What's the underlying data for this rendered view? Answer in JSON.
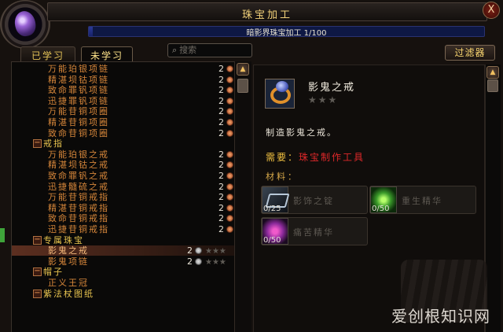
{
  "window": {
    "title": "珠宝加工",
    "close_label": "X"
  },
  "skill": {
    "text": "暗影界珠宝加工 1/100",
    "progress": 0.01
  },
  "tabs": [
    {
      "label": "已学习",
      "active": false
    },
    {
      "label": "未学习",
      "active": true
    }
  ],
  "search": {
    "placeholder": "搜索"
  },
  "filter": {
    "label": "过滤器"
  },
  "list": {
    "rows": [
      {
        "kind": "recipe",
        "name": "万能珀银项链",
        "count": "2"
      },
      {
        "kind": "recipe",
        "name": "精湛坝钴项链",
        "count": "2"
      },
      {
        "kind": "recipe",
        "name": "致命罪钒项链",
        "count": "2"
      },
      {
        "kind": "recipe",
        "name": "迅捷罪钒项链",
        "count": "2"
      },
      {
        "kind": "recipe",
        "name": "万能苷铜项圈",
        "count": "2"
      },
      {
        "kind": "recipe",
        "name": "精湛苷铜项圈",
        "count": "2"
      },
      {
        "kind": "recipe",
        "name": "致命苷铜项圈",
        "count": "2"
      },
      {
        "kind": "category",
        "name": "戒指"
      },
      {
        "kind": "recipe",
        "name": "万能珀银之戒",
        "count": "2"
      },
      {
        "kind": "recipe",
        "name": "精湛坝钴之戒",
        "count": "2"
      },
      {
        "kind": "recipe",
        "name": "致命罪钒之戒",
        "count": "2"
      },
      {
        "kind": "recipe",
        "name": "迅捷髓硫之戒",
        "count": "2"
      },
      {
        "kind": "recipe",
        "name": "万能苷铜戒指",
        "count": "2"
      },
      {
        "kind": "recipe",
        "name": "精湛苷铜戒指",
        "count": "2"
      },
      {
        "kind": "recipe",
        "name": "致命苷铜戒指",
        "count": "2"
      },
      {
        "kind": "recipe",
        "name": "迅捷苷铜戒指",
        "count": "2"
      },
      {
        "kind": "category",
        "name": "专属珠宝"
      },
      {
        "kind": "sub",
        "name": "影鬼之戒",
        "count": "2",
        "selected": true
      },
      {
        "kind": "sub",
        "name": "影鬼项链",
        "count": "2"
      },
      {
        "kind": "category",
        "name": "帽子"
      },
      {
        "kind": "recipe",
        "name": "正义王冠"
      },
      {
        "kind": "category",
        "name": "紫法杖图纸"
      }
    ]
  },
  "detail": {
    "item_name": "影鬼之戒",
    "quality_stars": "★★★",
    "description": "制造影鬼之戒。",
    "requires_label": "需要：",
    "requires_value": "珠宝制作工具",
    "materials_label": "材料：",
    "reagents": [
      {
        "name": "影饰之锭",
        "count": "0/25",
        "icon": "ingot-icon"
      },
      {
        "name": "重生精华",
        "count": "0/50",
        "icon": "green-essence-icon"
      },
      {
        "name": "痛苦精华",
        "count": "0/50",
        "icon": "purple-essence-icon"
      }
    ]
  },
  "watermark": "爱创根知识网",
  "colors": {
    "title_gold": "#f3d27a",
    "recipe_orange": "#d6863a",
    "category_yellow": "#e6c24e",
    "requirement_red": "#e0282a"
  }
}
